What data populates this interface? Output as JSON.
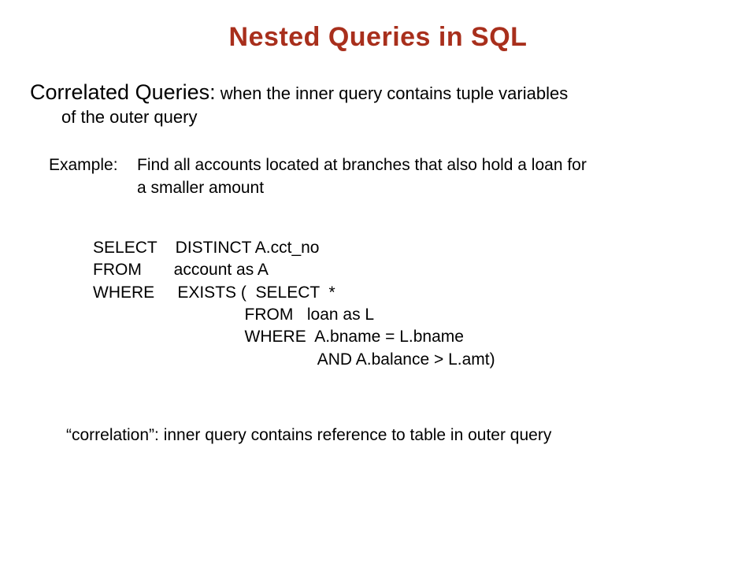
{
  "title": "Nested Queries in SQL",
  "lead": {
    "strong": "Correlated Queries:",
    "rest": " when the inner query contains tuple variables",
    "cont": "of the outer query"
  },
  "example": {
    "label": "Example:",
    "text_l1": "Find all accounts located at branches that also hold a loan for",
    "text_l2": "a smaller amount"
  },
  "code": {
    "l1": "SELECT    DISTINCT A.cct_no",
    "l2": "FROM       account as A",
    "l3": "WHERE     EXISTS (  SELECT  *",
    "l4": "                                 FROM   loan as L",
    "l5": "                                 WHERE  A.bname = L.bname",
    "l6": "                                                 AND A.balance > L.amt)"
  },
  "footnote": "“correlation”:  inner query contains reference to table in outer query"
}
